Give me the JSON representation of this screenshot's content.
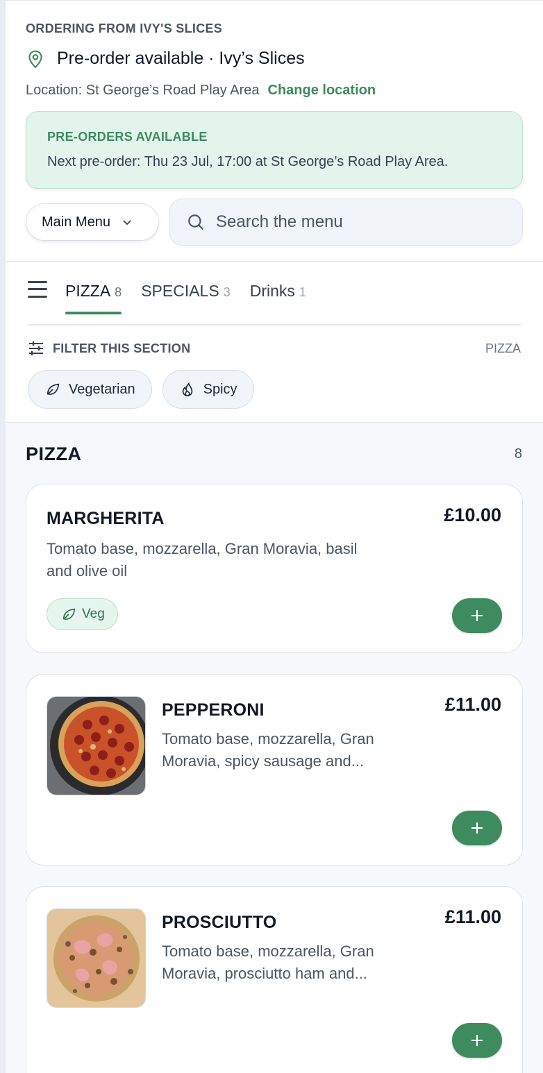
{
  "header": {
    "eyebrow": "ORDERING FROM IVY'S SLICES",
    "venue_title": "Pre-order available · Ivy’s Slices",
    "location_label": "Location: St George’s Road Play Area",
    "change_location": "Change location"
  },
  "notice": {
    "title": "PRE-ORDERS AVAILABLE",
    "text": "Next pre-order: Thu 23 Jul, 17:00 at St George’s Road Play Area."
  },
  "controls": {
    "menu_select": "Main Menu",
    "search_placeholder": "Search the menu"
  },
  "tabs": [
    {
      "label": "PIZZA",
      "count": "8",
      "active": true
    },
    {
      "label": "SPECIALS",
      "count": "3",
      "active": false
    },
    {
      "label": "Drinks",
      "count": "1",
      "active": false
    }
  ],
  "filter": {
    "label": "FILTER THIS SECTION",
    "section": "PIZZA",
    "chips": [
      "Vegetarian",
      "Spicy"
    ]
  },
  "section": {
    "title": "PIZZA",
    "count": "8"
  },
  "items": [
    {
      "name": "MARGHERITA",
      "price": "£10.00",
      "desc_line1": "Tomato base, mozzarella, Gran Moravia, basil",
      "desc_line2": "and olive oil",
      "badge": "Veg"
    },
    {
      "name": "PEPPERONI",
      "price": "£11.00",
      "desc_line1": "Tomato base, mozzarella, Gran",
      "desc_line2": "Moravia, spicy sausage and..."
    },
    {
      "name": "PROSCIUTTO",
      "price": "£11.00",
      "desc_line1": "Tomato base, mozzarella, Gran",
      "desc_line2": "Moravia, prosciutto ham and..."
    }
  ],
  "colors": {
    "accent": "#3d8b5f",
    "notice_bg": "#e3f4ec"
  }
}
